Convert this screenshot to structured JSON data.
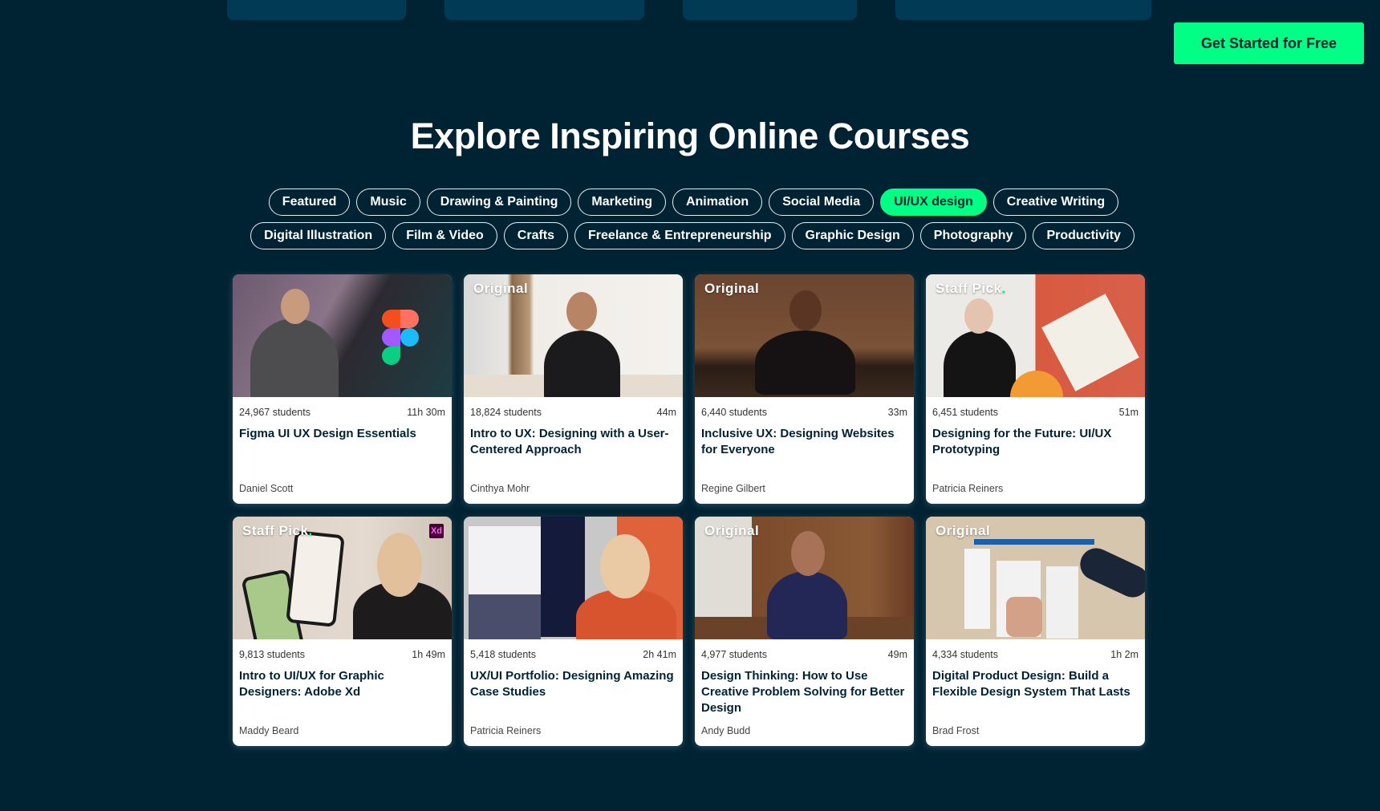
{
  "header": {
    "cta_label": "Get Started for Free"
  },
  "section": {
    "heading": "Explore Inspiring Online Courses"
  },
  "categories": {
    "row1": [
      "Featured",
      "Music",
      "Drawing & Painting",
      "Marketing",
      "Animation",
      "Social Media",
      "UI/UX design",
      "Creative Writing"
    ],
    "row2": [
      "Digital Illustration",
      "Film & Video",
      "Crafts",
      "Freelance & Entrepreneurship",
      "Graphic Design",
      "Photography",
      "Productivity"
    ],
    "active": "UI/UX design"
  },
  "colors": {
    "background": "#002333",
    "accent": "#00ff84",
    "top_block": "#003a55"
  },
  "courses": [
    {
      "badge": "",
      "students": "24,967 students",
      "duration": "11h 30m",
      "title": "Figma UI UX Design Essentials",
      "author": "Daniel Scott"
    },
    {
      "badge": "Original",
      "students": "18,824 students",
      "duration": "44m",
      "title": "Intro to UX: Designing with a User-Centered Approach",
      "author": "Cinthya Mohr"
    },
    {
      "badge": "Original",
      "students": "6,440 students",
      "duration": "33m",
      "title": "Inclusive UX: Designing Websites for Everyone",
      "author": "Regine Gilbert"
    },
    {
      "badge": "Staff Pick",
      "students": "6,451 students",
      "duration": "51m",
      "title": "Designing for the Future: UI/UX Prototyping",
      "author": "Patricia Reiners"
    },
    {
      "badge": "Staff Pick",
      "students": "9,813 students",
      "duration": "1h 49m",
      "title": "Intro to UI/UX for Graphic Designers: Adobe Xd",
      "author": "Maddy Beard",
      "corner_icon": "Xd"
    },
    {
      "badge": "",
      "students": "5,418 students",
      "duration": "2h 41m",
      "title": "UX/UI Portfolio: Designing Amazing Case Studies",
      "author": "Patricia Reiners"
    },
    {
      "badge": "Original",
      "students": "4,977 students",
      "duration": "49m",
      "title": "Design Thinking: How to Use Creative Problem Solving for Better Design",
      "author": "Andy Budd"
    },
    {
      "badge": "Original",
      "students": "4,334 students",
      "duration": "1h 2m",
      "title": "Digital Product Design: Build a Flexible Design System That Lasts",
      "author": "Brad Frost"
    }
  ]
}
